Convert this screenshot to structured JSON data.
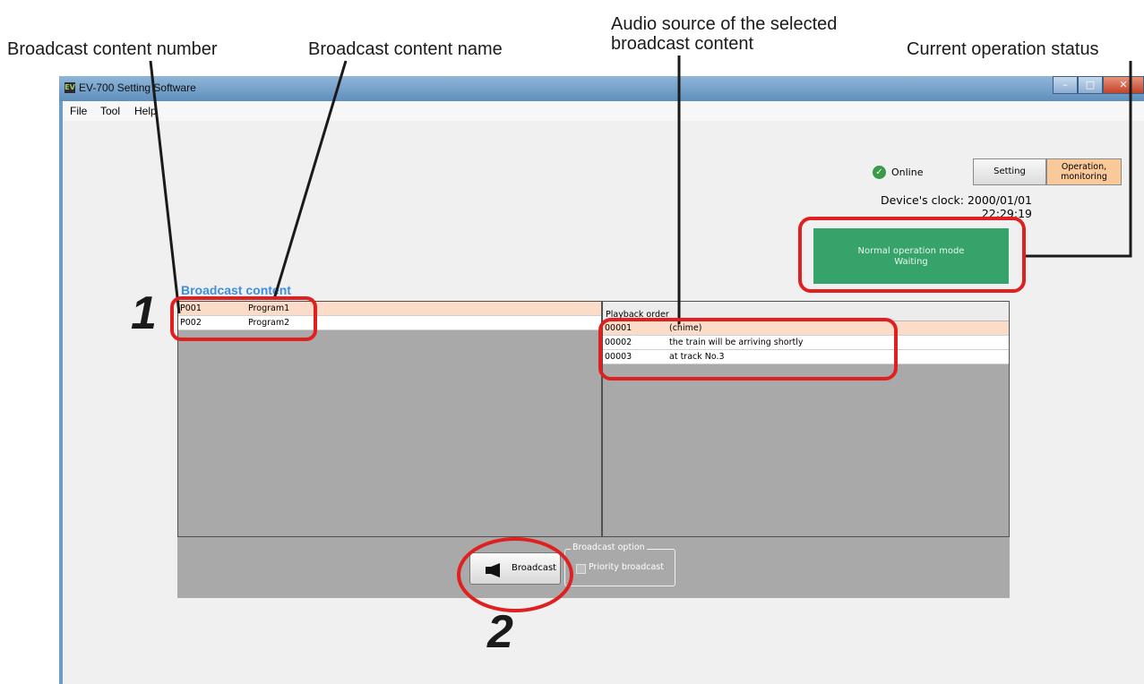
{
  "callouts": {
    "content_number": "Broadcast content number",
    "content_name": "Broadcast content name",
    "audio_source_line1": "Audio source of the selected",
    "audio_source_line2": "broadcast content",
    "operation_status": "Current operation status",
    "step1": "1",
    "step2": "2"
  },
  "window": {
    "icon_text": "EV",
    "title": "EV-700 Setting Software"
  },
  "menu": [
    "File",
    "Tool",
    "Help"
  ],
  "header": {
    "online_label": "Online",
    "setting_button": "Setting",
    "operation_button_line1": "Operation,",
    "operation_button_line2": "monitoring"
  },
  "clock": {
    "label": "Device's clock: 2000/01/01",
    "time": "22:29:19"
  },
  "status": {
    "line1": "Normal operation mode",
    "line2": "Waiting",
    "color": "#36a36a"
  },
  "broadcast_content": {
    "title": "Broadcast content",
    "rows": [
      {
        "number": "P001",
        "name": "Program1",
        "selected": true
      },
      {
        "number": "P002",
        "name": "Program2",
        "selected": false
      }
    ]
  },
  "playback": {
    "header": "Playback order",
    "rows": [
      {
        "number": "00001",
        "name": "(chime)",
        "selected": true
      },
      {
        "number": "00002",
        "name": "the train will be arriving shortly",
        "selected": false
      },
      {
        "number": "00003",
        "name": "at track No.3",
        "selected": false
      }
    ]
  },
  "controls": {
    "broadcast_button": "Broadcast",
    "option_group": "Broadcast option",
    "priority_label": "Priority broadcast",
    "priority_checked": false
  },
  "colors": {
    "accent_title": "#3b8fe2",
    "selection": "#fbdcc8",
    "highlight_ring": "#e02020",
    "operation_button": "#f9c99a"
  }
}
